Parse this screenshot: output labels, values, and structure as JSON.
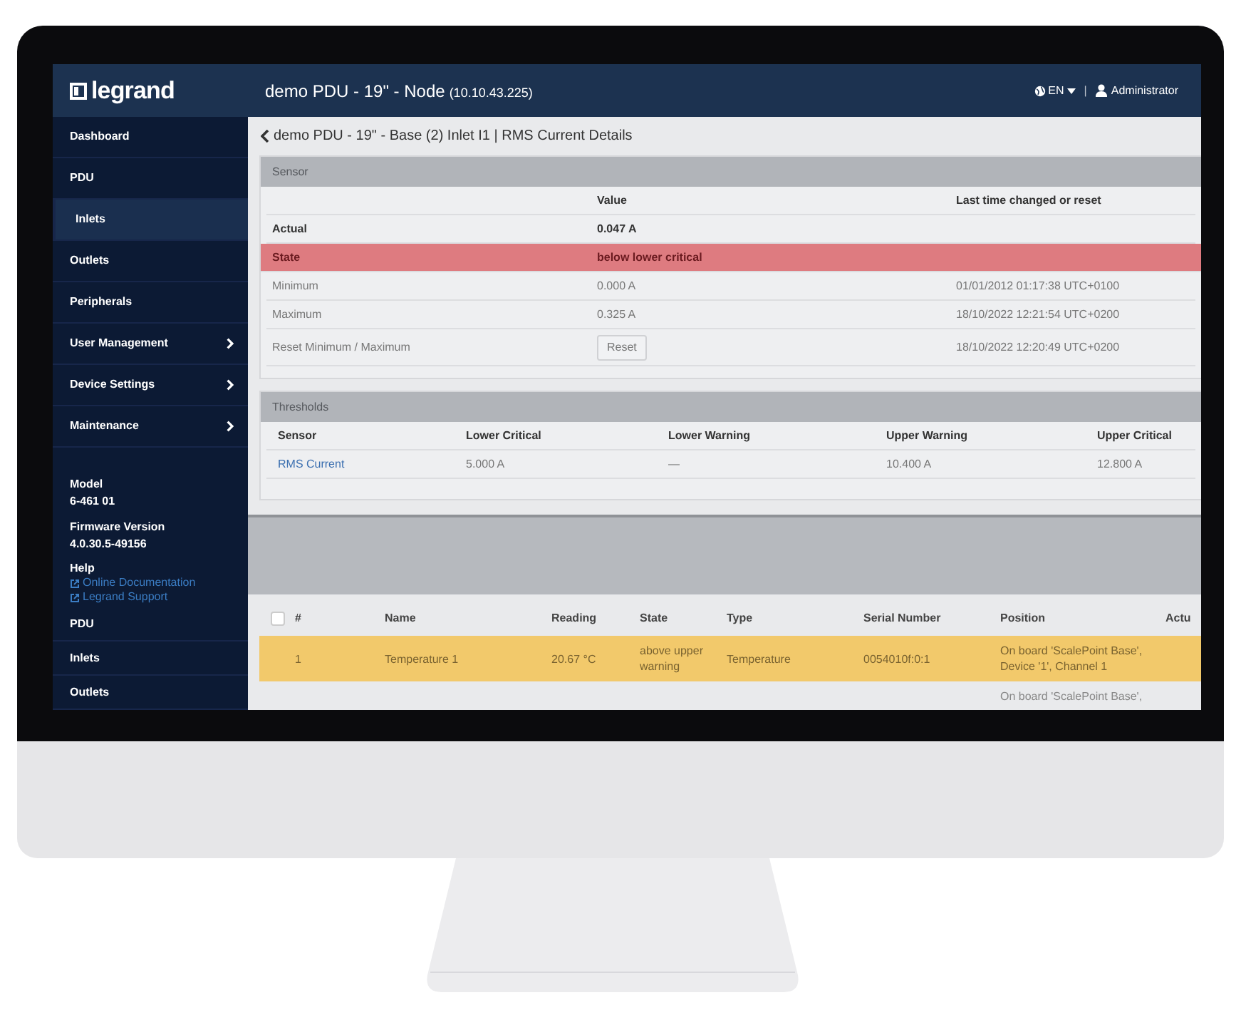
{
  "header": {
    "logo": "legrand",
    "title": "demo PDU - 19\" - Node",
    "address": "(10.10.43.225)",
    "language": "EN",
    "separator": "|",
    "user": "Administrator"
  },
  "sidebar": {
    "items": [
      {
        "label": "Dashboard",
        "selected": false,
        "submenu": false
      },
      {
        "label": "PDU",
        "selected": false,
        "submenu": false
      },
      {
        "label": "Inlets",
        "selected": true,
        "submenu": false
      },
      {
        "label": "Outlets",
        "selected": false,
        "submenu": false
      },
      {
        "label": "Peripherals",
        "selected": false,
        "submenu": false
      },
      {
        "label": "User Management",
        "selected": false,
        "submenu": true
      },
      {
        "label": "Device Settings",
        "selected": false,
        "submenu": true
      },
      {
        "label": "Maintenance",
        "selected": false,
        "submenu": true
      }
    ],
    "info": [
      {
        "label": "Model",
        "value": "6-461 01"
      },
      {
        "label": "Firmware Version",
        "value": "4.0.30.5-49156"
      }
    ],
    "help": {
      "label": "Help",
      "links": [
        "Online Documentation",
        "Legrand Support"
      ]
    },
    "more_items": [
      {
        "label": "PDU"
      },
      {
        "label": "Inlets"
      },
      {
        "label": "Outlets"
      }
    ]
  },
  "breadcrumb": "demo PDU - 19\" - Base (2) Inlet I1 | RMS Current Details",
  "sensor": {
    "title": "Sensor",
    "columns": [
      "Value",
      "Last time changed or reset"
    ],
    "rows": [
      {
        "kind": "strong",
        "label": "Actual",
        "value": "0.047 A"
      },
      {
        "kind": "alert",
        "label": "State",
        "value": "below lower critical"
      },
      {
        "kind": "plain",
        "label": "Minimum",
        "value": "0.000 A",
        "time": "01/01/2012 01:17:38 UTC+0100"
      },
      {
        "kind": "plain",
        "label": "Maximum",
        "value": "0.325 A",
        "time": "18/10/2022 12:21:54 UTC+0200"
      },
      {
        "kind": "action",
        "label": "Reset Minimum / Maximum",
        "value": "Reset",
        "time": "18/10/2022 12:20:49 UTC+0200"
      }
    ]
  },
  "thresholds": {
    "title": "Thresholds",
    "columns": [
      "Sensor",
      "Lower Critical",
      "Lower Warning",
      "Upper Warning",
      "Upper Critical"
    ],
    "rows": [
      [
        "RMS Current",
        "5.000 A",
        "—",
        "10.400 A",
        "12.800 A"
      ]
    ]
  },
  "peripherals": {
    "select_all": {
      "checked": false
    },
    "columns": [
      "#",
      "Name",
      "Reading",
      "State",
      "Type",
      "Serial Number",
      "Position",
      "Actu"
    ],
    "rows": [
      {
        "highlighted": true,
        "cells": [
          "1",
          "Temperature 1",
          "20.67 °C",
          "above upper warning",
          "Temperature",
          "0054010f:0:1",
          "On board 'ScalePoint Base', Device '1', Channel 1"
        ]
      },
      {
        "highlighted": false,
        "cells": [
          "",
          "",
          "",
          "",
          "",
          "",
          "On board 'ScalePoint Base',"
        ]
      }
    ]
  }
}
